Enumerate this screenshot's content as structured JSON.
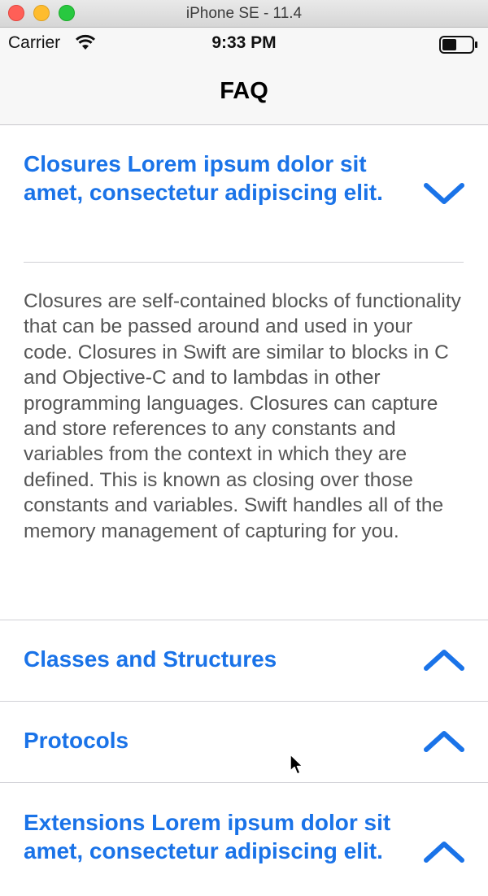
{
  "window": {
    "title": "iPhone SE - 11.4"
  },
  "status_bar": {
    "carrier": "Carrier",
    "time": "9:33 PM"
  },
  "nav": {
    "title": "FAQ"
  },
  "faq": [
    {
      "question": "Closures Lorem ipsum dolor sit amet, consectetur adipiscing elit.",
      "expanded": true,
      "answer": "Closures are self-contained blocks of functionality that can be passed around and used in your code. Closures in Swift are similar to blocks in C and Objective-C and to lambdas in other programming languages. Closures can capture and store references to any constants and variables from the context in which they are defined. This is known as closing over those constants and variables. Swift handles all of the memory management of capturing for you."
    },
    {
      "question": "Classes and Structures",
      "expanded": false
    },
    {
      "question": "Protocols",
      "expanded": false
    },
    {
      "question": "Extensions Lorem ipsum dolor sit amet, consectetur adipiscing elit.",
      "expanded": false
    }
  ],
  "colors": {
    "accent": "#1a73e8",
    "answer_text": "#555555"
  }
}
